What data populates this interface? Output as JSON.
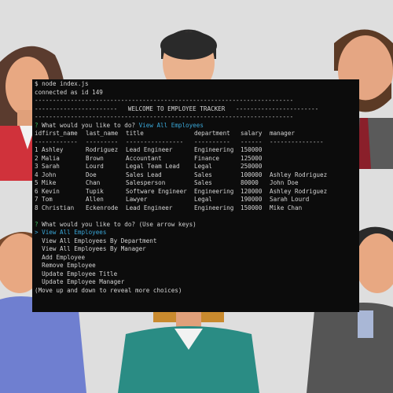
{
  "terminal": {
    "command_line": "$ node index.js",
    "connected": "connected as id 149",
    "divider": "------------------------------------------------------------------------",
    "welcome_left": "-----------------------",
    "welcome_title": "WELCOME TO EMPLOYEE TRACKER",
    "welcome_right": "-----------------------",
    "q1_mark": "?",
    "q1_text": "What would you like to do?",
    "q1_answer": "View All Employees",
    "table": {
      "headers": [
        "id",
        "first_name",
        "last_name",
        "title",
        "department",
        "salary",
        "manager"
      ],
      "separators": [
        "--",
        "----------",
        "---------",
        "----------------",
        "----------",
        "------",
        "---------------"
      ],
      "rows": [
        [
          "1",
          "Ashley",
          "Rodriguez",
          "Lead Engineer",
          "Engineering",
          "150000",
          ""
        ],
        [
          "2",
          "Malia",
          "Brown",
          "Accountant",
          "Finance",
          "125000",
          ""
        ],
        [
          "3",
          "Sarah",
          "Lourd",
          "Legal Team Lead",
          "Legal",
          "250000",
          ""
        ],
        [
          "4",
          "John",
          "Doe",
          "Sales Lead",
          "Sales",
          "100000",
          "Ashley Rodriguez"
        ],
        [
          "5",
          "Mike",
          "Chan",
          "Salesperson",
          "Sales",
          "80000",
          "John Doe"
        ],
        [
          "6",
          "Kevin",
          "Tupik",
          "Software Engineer",
          "Engineering",
          "120000",
          "Ashley Rodriguez"
        ],
        [
          "7",
          "Tom",
          "Allen",
          "Lawyer",
          "Legal",
          "190000",
          "Sarah Lourd"
        ],
        [
          "8",
          "Christian",
          "Eckenrode",
          "Lead Engineer",
          "Engineering",
          "150000",
          "Mike Chan"
        ]
      ]
    },
    "q2_mark": "?",
    "q2_text": "What would you like to do?",
    "q2_hint": "(Use arrow keys)",
    "menu": {
      "pointer": ">",
      "selected": "View All Employees",
      "items": [
        "View All Employees By Department",
        "View All Employees By Manager",
        "Add Employee",
        "Remove Employee",
        "Update Employee Title",
        "Update Employee Manager"
      ],
      "more_hint": "(Move up and down to reveal more choices)"
    }
  },
  "colors": {
    "terminal_bg": "#0c0c0c",
    "prompt_green": "#3fbf5f",
    "accent_cyan": "#3aa7d8",
    "page_bg": "#dcdcdc"
  }
}
